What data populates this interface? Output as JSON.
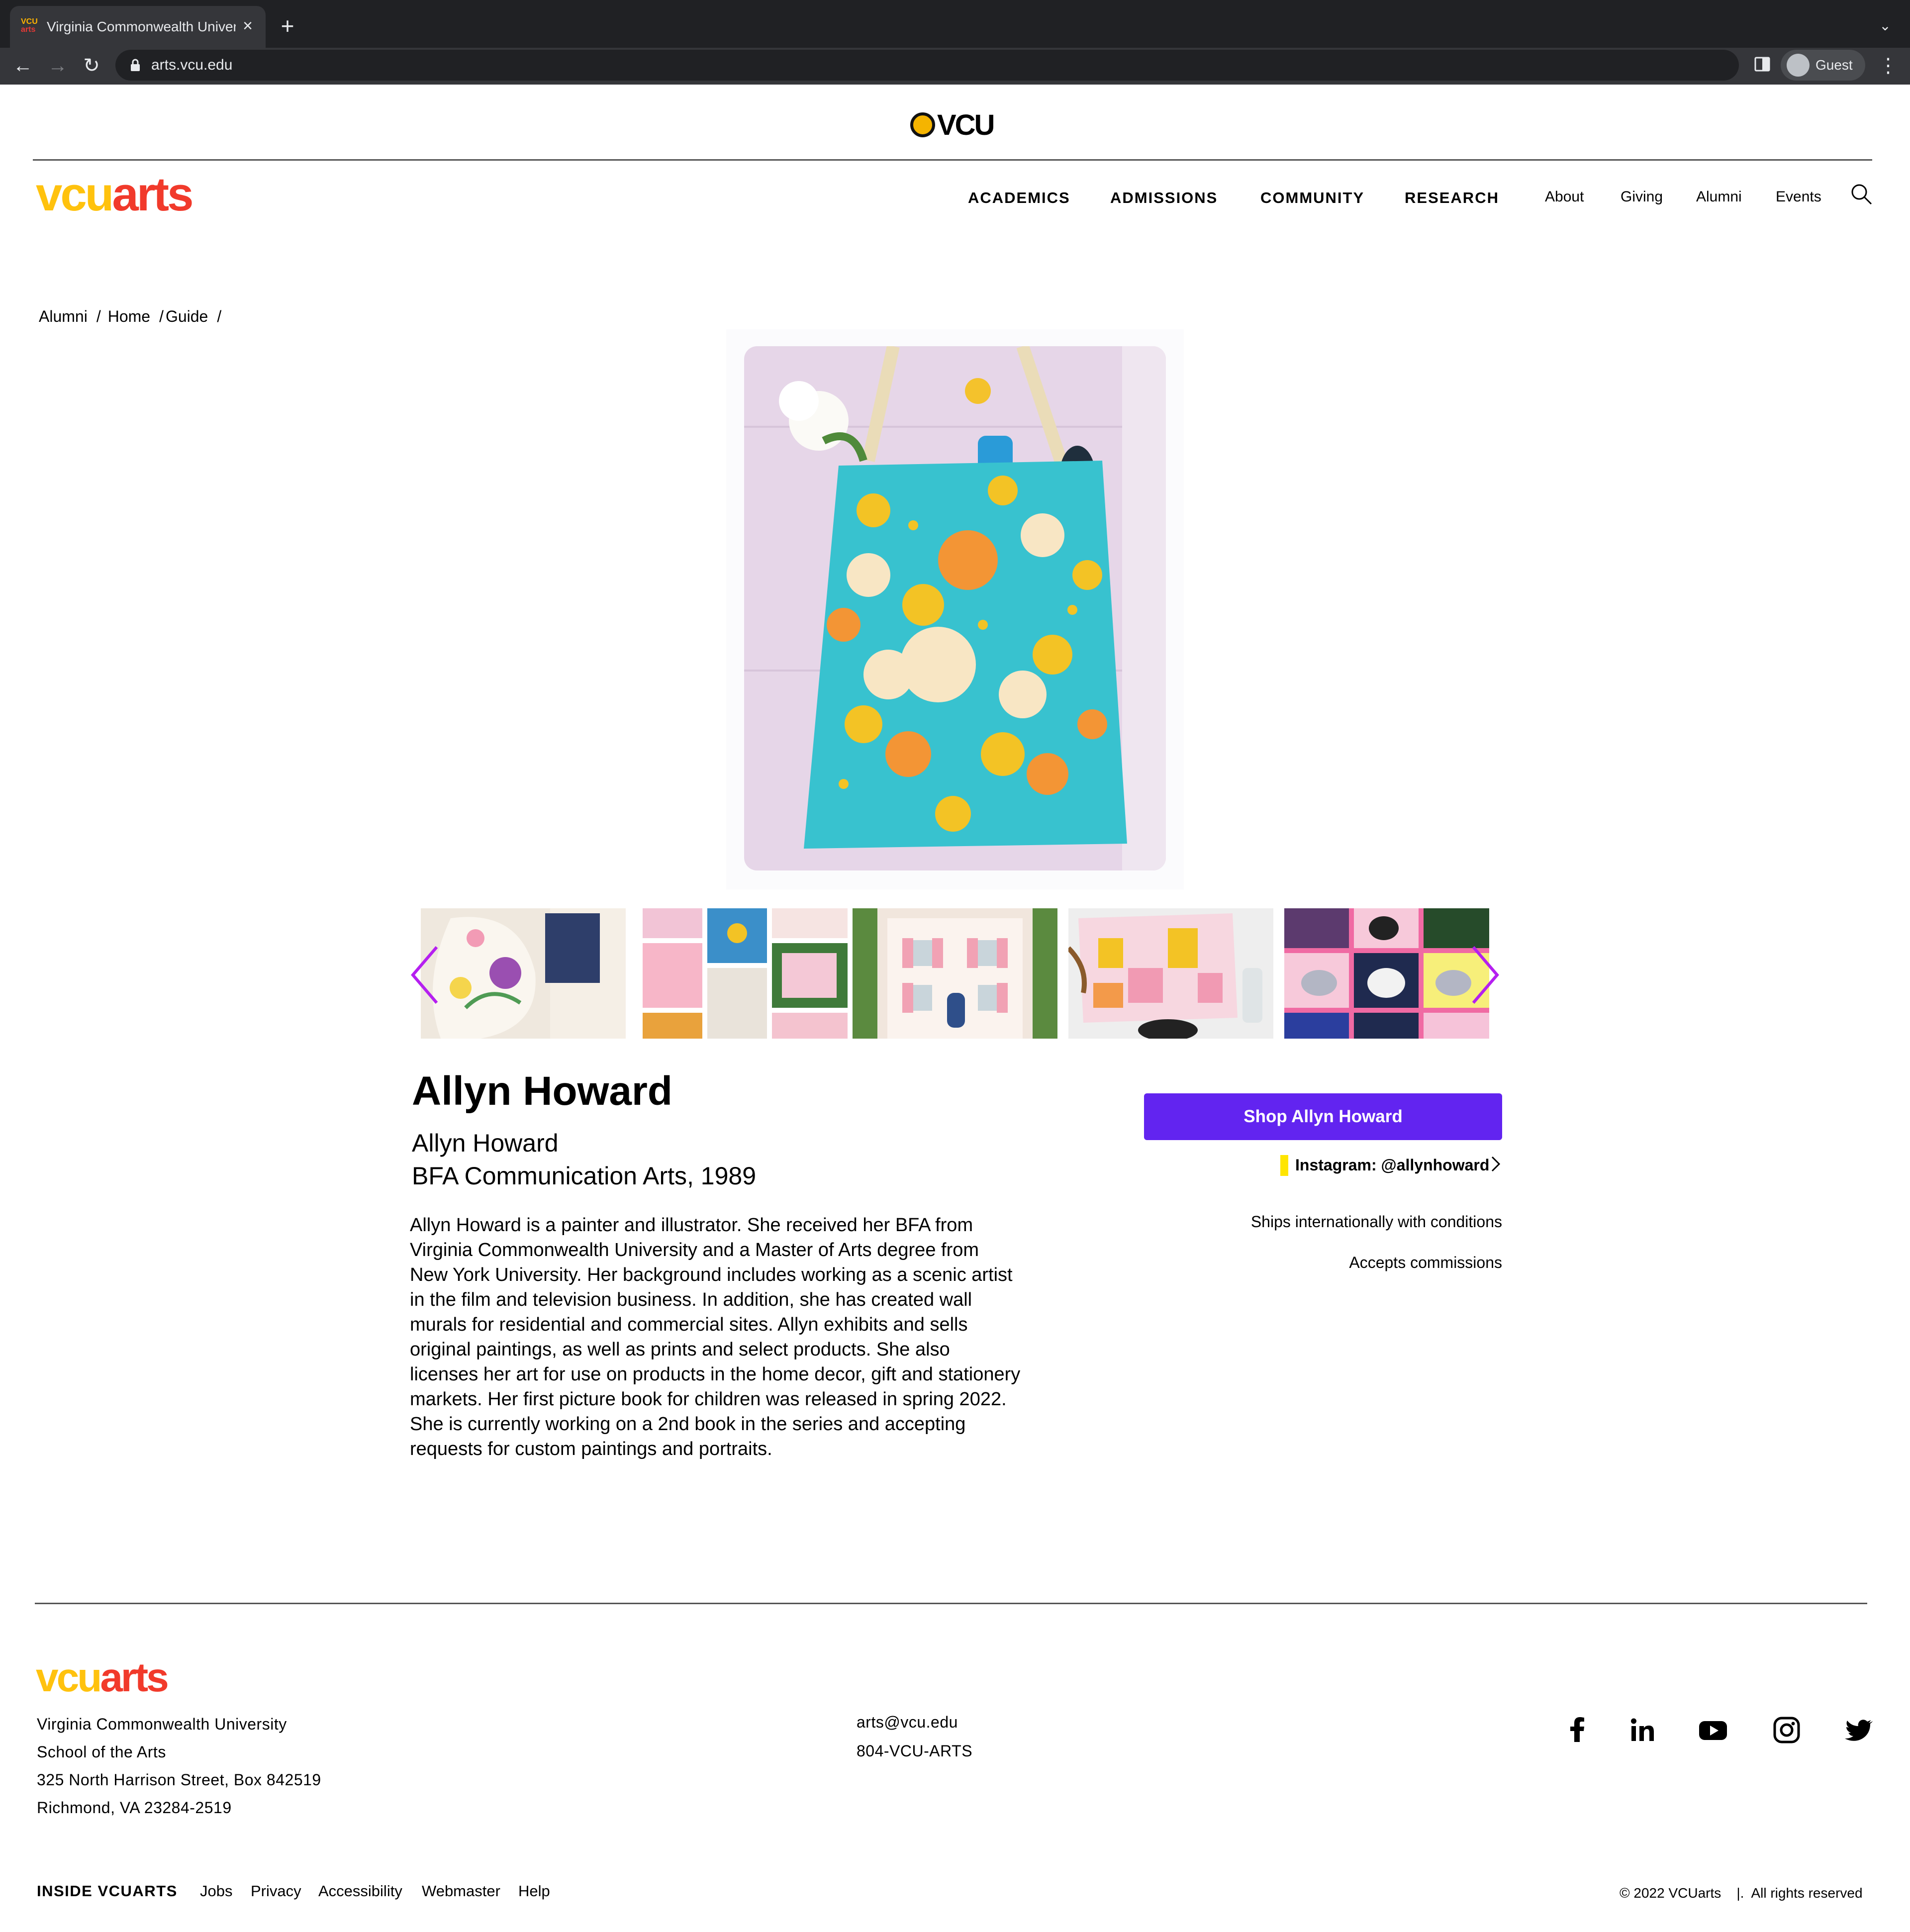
{
  "browser": {
    "tab_title": "Virginia Commonwealth University",
    "favicon_top": "VCU",
    "favicon_bottom": "arts",
    "tab_close": "×",
    "new_tab": "+",
    "tab_menu": "⌄",
    "url": "arts.vcu.edu",
    "profile": "Guest",
    "back": "←",
    "forward": "→",
    "reload": "↻",
    "menu": "⋮"
  },
  "header": {
    "vcu_logo": "VCU",
    "brand_y": "vcu",
    "brand_r": "arts",
    "nav": [
      "ACADEMICS",
      "ADMISSIONS",
      "COMMUNITY",
      "RESEARCH"
    ],
    "subnav": [
      "About",
      "Giving",
      "Alumni",
      "Events"
    ]
  },
  "breadcrumb": {
    "items": [
      "Alumni",
      "Home",
      "Guide"
    ],
    "separator": "/"
  },
  "profile": {
    "name": "Allyn Howard",
    "subname": "Allyn Howard",
    "degree": "BFA Communication Arts, 1989",
    "bio": "Allyn Howard is a painter and illustrator. She received her BFA from Virginia Commonwealth University and a Master of Arts degree from New York University. Her background includes working as a scenic artist in the film and television business. In addition, she has created wall murals for residential and commercial sites. Allyn exhibits and sells original paintings, as well as prints and select products. She also licenses her art for use on products in the home decor, gift and stationery markets. Her first picture book for children was released in spring 2022. She is currently working on a 2nd book in the series and accepting requests for  custom paintings and portraits.",
    "shop_label": "Shop Allyn Howard",
    "instagram_label": "Instagram: @allynhoward",
    "ships": "Ships internationally with conditions",
    "commissions": "Accepts commissions"
  },
  "footer": {
    "brand_y": "vcu",
    "brand_r": "arts",
    "address": [
      "Virginia Commonwealth University",
      "School of the Arts",
      "325 North Harrison Street, Box 842519",
      "Richmond, VA 23284-2519"
    ],
    "email": "arts@vcu.edu",
    "phone": "804-VCU-ARTS",
    "social_icons": [
      "facebook-icon",
      "linkedin-icon",
      "youtube-icon",
      "instagram-icon",
      "twitter-icon"
    ],
    "inside_label": "INSIDE VCUARTS",
    "links": [
      "Jobs",
      "Privacy",
      "Accessibility",
      "Webmaster",
      "Help"
    ],
    "copyright": "© 2022 VCUarts    |.  All rights reserved"
  },
  "colors": {
    "brand_yellow": "#ffc20e",
    "brand_red": "#f13a2b",
    "shop_button": "#6224f0",
    "carousel_arrow": "#b51ff0",
    "instagram_mark": "#ffe500"
  }
}
